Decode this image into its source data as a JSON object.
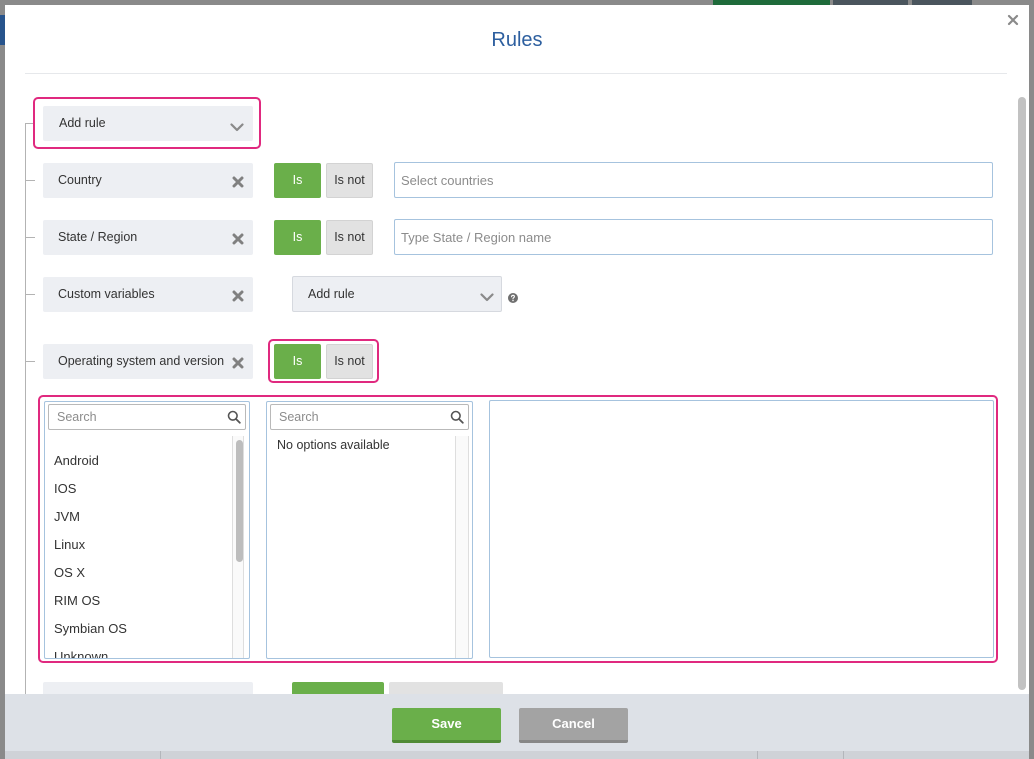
{
  "modal": {
    "title": "Rules",
    "close_icon": "close-icon"
  },
  "rules": {
    "add_rule": {
      "label": "Add rule",
      "icon": "chevron-down-icon"
    },
    "items": [
      {
        "label": "Country",
        "remove_icon": "close-icon",
        "operator": {
          "is": "Is",
          "is_not": "Is not",
          "is_selected": true
        },
        "input": {
          "placeholder": "Select countries",
          "value": ""
        }
      },
      {
        "label": "State / Region",
        "remove_icon": "close-icon",
        "operator": {
          "is": "Is",
          "is_not": "Is not",
          "is_selected": true
        },
        "input": {
          "placeholder": "Type State / Region name",
          "value": ""
        }
      },
      {
        "label": "Custom variables",
        "remove_icon": "close-icon",
        "add_rule": {
          "label": "Add rule",
          "icon": "chevron-down-icon"
        },
        "help_icon": "question-icon"
      },
      {
        "label": "Operating system and version",
        "remove_icon": "close-icon",
        "operator": {
          "is": "Is",
          "is_not": "Is not",
          "is_selected": true
        }
      }
    ],
    "os_picker": {
      "systems": {
        "search_placeholder": "Search",
        "search_icon": "search-icon",
        "options": [
          "Android",
          "IOS",
          "JVM",
          "Linux",
          "OS X",
          "RIM OS",
          "Symbian OS",
          "Unknown"
        ]
      },
      "versions": {
        "search_placeholder": "Search",
        "search_icon": "search-icon",
        "empty_text": "No options available",
        "options": []
      },
      "selected": []
    }
  },
  "footer": {
    "save_label": "Save",
    "cancel_label": "Cancel"
  },
  "colors": {
    "title": "#2d5f9f",
    "accent_green": "#6aaf4a",
    "highlight": "#e0297f",
    "input_border": "#a6c3de",
    "cancel_button": "#a3a3a3",
    "footer_background": "#dde1e7"
  }
}
